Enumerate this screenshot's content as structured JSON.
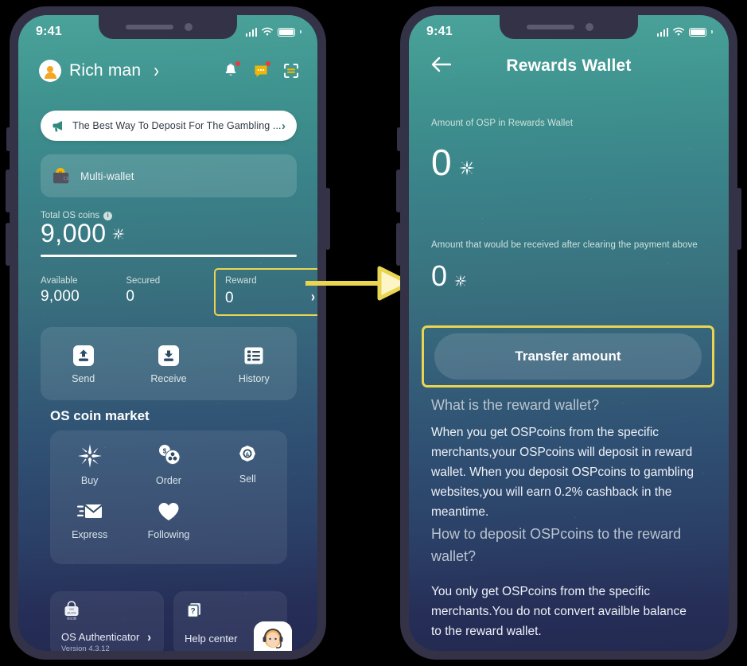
{
  "background_color": "#000000",
  "frame_color": "#343247",
  "highlight_color": "#e9d552",
  "arrow": {
    "name": "flow-arrow",
    "color": "#e9d552",
    "fill": "#fdf5c8"
  },
  "left_phone": {
    "status_bar": {
      "time": "9:41",
      "signal": "signal-bars-icon",
      "wifi": "wifi-icon",
      "battery": "battery-full-icon"
    },
    "header": {
      "avatar": "user-avatar-icon",
      "username": "Rich man",
      "profile_chevron": "›",
      "icons": [
        {
          "name": "bell-icon",
          "badge": true
        },
        {
          "name": "message-icon",
          "badge": true
        },
        {
          "name": "scan-icon",
          "badge": false
        }
      ]
    },
    "banner": {
      "icon": "megaphone-icon",
      "text": "The Best Way To Deposit For The Gambling ...",
      "chevron": "›"
    },
    "multi_wallet": {
      "icon": "wallet-coin-icon",
      "label": "Multi-wallet"
    },
    "totals": {
      "label": "Total OS coins",
      "info_icon": "info-icon",
      "value": "9,000",
      "coin_icon": "osp-sparkle-icon"
    },
    "stats": [
      {
        "label": "Available",
        "value": "9,000"
      },
      {
        "label": "Secured",
        "value": "0"
      },
      {
        "label": "Reward",
        "value": "0",
        "highlighted": true,
        "chevron": "›"
      }
    ],
    "actions": [
      {
        "icon": "send-icon",
        "label": "Send"
      },
      {
        "icon": "receive-icon",
        "label": "Receive"
      },
      {
        "icon": "history-icon",
        "label": "History"
      }
    ],
    "market": {
      "title": "OS coin market",
      "items": [
        {
          "icon": "buy-sparkle-icon",
          "label": "Buy"
        },
        {
          "icon": "order-coins-icon",
          "label": "Order"
        },
        {
          "icon": "sell-coin-icon",
          "label": "Sell"
        },
        {
          "icon": "express-envelope-icon",
          "label": "Express"
        },
        {
          "icon": "heart-icon",
          "label": "Following"
        }
      ]
    },
    "bottom": {
      "authenticator": {
        "icon": "authenticator-icon",
        "label": "OS Authenticator",
        "chevron": "›",
        "version": "Version 4.3.12"
      },
      "help": {
        "icon": "question-docs-icon",
        "label": "Help center",
        "avatar": "support-agent-avatar"
      }
    }
  },
  "right_phone": {
    "status_bar": {
      "time": "9:41",
      "signal": "signal-bars-icon",
      "wifi": "wifi-icon",
      "battery": "battery-full-icon"
    },
    "header": {
      "back_icon": "back-arrow-icon",
      "title": "Rewards Wallet"
    },
    "amount_primary": {
      "label": "Amount of OSP in Rewards Wallet",
      "value": "0",
      "coin_icon": "osp-sparkle-icon"
    },
    "amount_secondary": {
      "label": "Amount that would be received after clearing the payment above",
      "value": "0",
      "coin_icon": "osp-sparkle-icon"
    },
    "transfer_button": {
      "label": "Transfer amount",
      "highlighted": true
    },
    "faq": [
      {
        "question": "What is the reward wallet?",
        "answer": "When you get OSPcoins from the specific merchants,your OSPcoins will deposit in reward wallet. When you deposit OSPcoins to gambling websites,you will earn 0.2% cashback in the meantime."
      },
      {
        "question": "How to deposit OSPcoins to the reward wallet?",
        "answer": "You only get OSPcoins from the specific merchants.You do not convert availble balance to the reward wallet."
      }
    ]
  }
}
